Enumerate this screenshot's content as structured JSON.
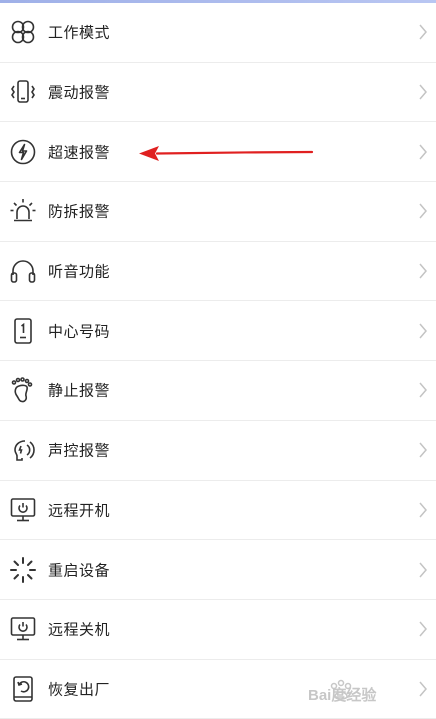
{
  "menu": {
    "items": [
      {
        "label": "工作模式",
        "icon": "four-petal-icon"
      },
      {
        "label": "震动报警",
        "icon": "phone-vibrate-icon"
      },
      {
        "label": "超速报警",
        "icon": "lightning-circle-icon"
      },
      {
        "label": "防拆报警",
        "icon": "siren-icon"
      },
      {
        "label": "听音功能",
        "icon": "headphones-icon"
      },
      {
        "label": "中心号码",
        "icon": "phone-number-icon"
      },
      {
        "label": "静止报警",
        "icon": "foot-icon"
      },
      {
        "label": "声控报警",
        "icon": "voice-control-icon"
      },
      {
        "label": "远程开机",
        "icon": "monitor-power-icon"
      },
      {
        "label": "重启设备",
        "icon": "loading-spinner-icon"
      },
      {
        "label": "远程关机",
        "icon": "monitor-power-icon"
      },
      {
        "label": "恢复出厂",
        "icon": "reset-phone-icon"
      }
    ]
  },
  "annotation": {
    "color": "#e02020",
    "points_to": "超速报警"
  },
  "watermark": {
    "text": "Bai度经验",
    "color": "#9a9a9a"
  },
  "colors": {
    "text": "#222222",
    "chevron": "#c4c4c4",
    "divider": "#ececec",
    "icon": "#333333"
  }
}
